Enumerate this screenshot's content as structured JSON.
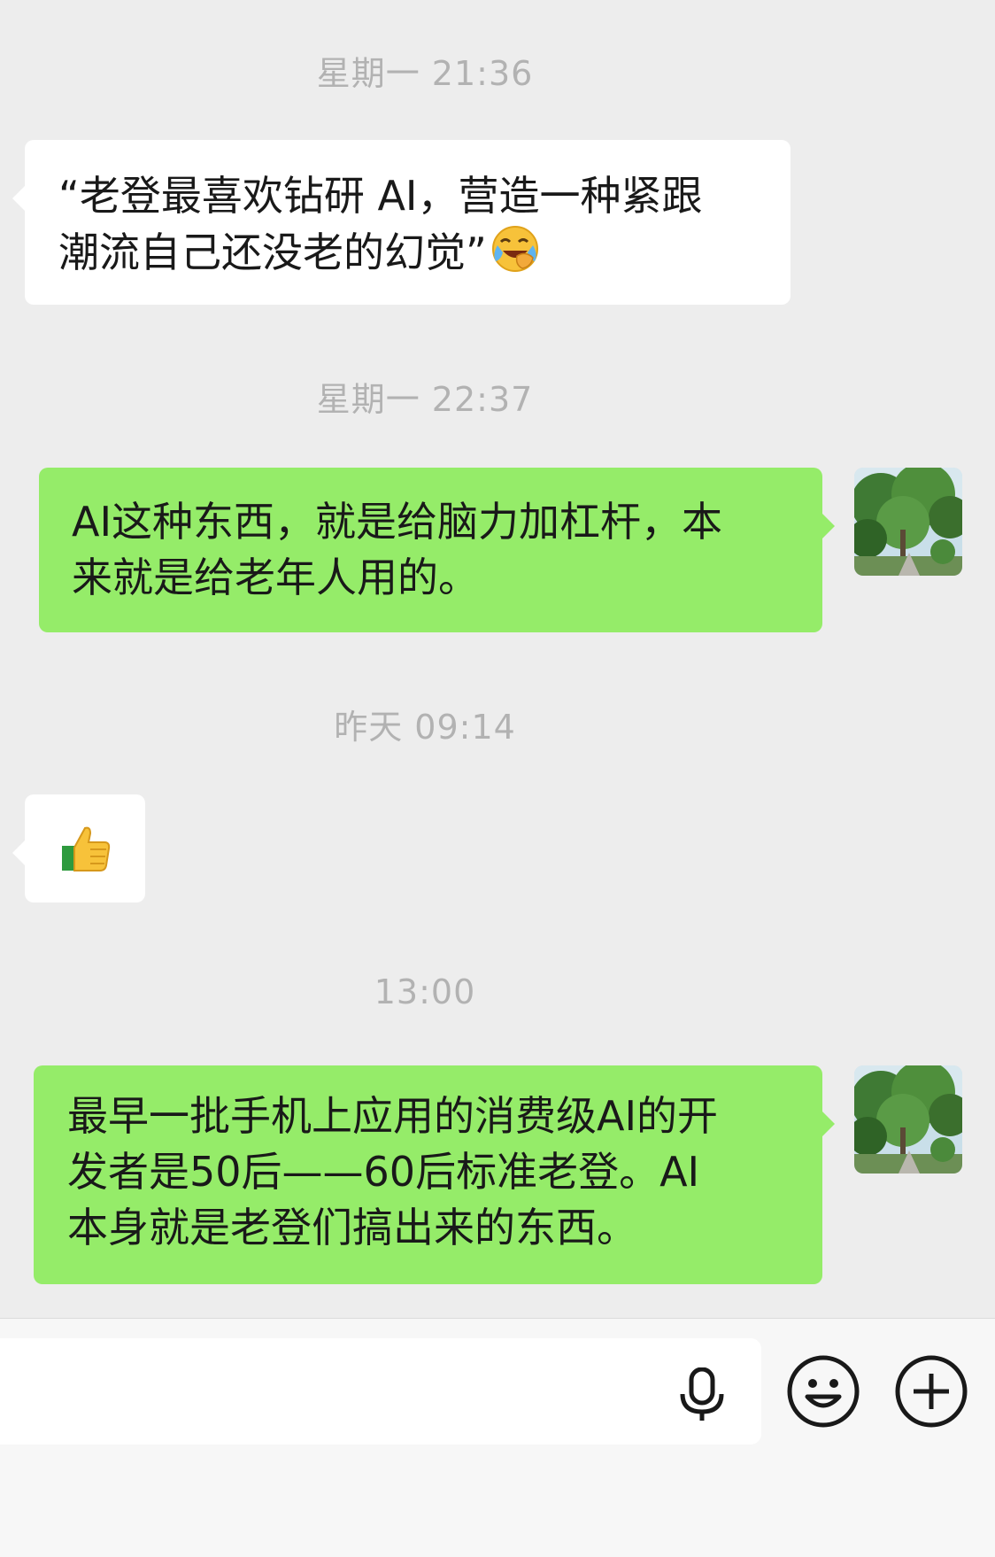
{
  "messages": [
    {
      "timestamp": "星期一 21:36",
      "side": "left",
      "lines": [
        "“老登最喜欢钻研 AI，营造一种紧跟",
        "潮流自己还没老的幻觉”"
      ],
      "trailing_emoji": "laughing-crying-emoji"
    },
    {
      "timestamp": "星期一 22:37",
      "side": "right",
      "lines": [
        "AI这种东西，就是给脑力加杠杆，本",
        "来就是给老年人用的。"
      ]
    },
    {
      "timestamp": "昨天 09:14",
      "side": "left",
      "emoji_only": "thumbs-up-emoji"
    },
    {
      "timestamp": "13:00",
      "side": "right",
      "lines": [
        "最早一批手机上应用的消费级AI的开",
        "发者是50后——60后标准老登。AI",
        "本身就是老登们搞出来的东西。"
      ]
    }
  ],
  "input_bar": {
    "icons": [
      "microphone-icon",
      "emoji-icon",
      "plus-icon"
    ]
  },
  "colors": {
    "background": "#ededed",
    "sent_bubble": "#95ec69",
    "received_bubble": "#ffffff",
    "timestamp": "#b2b2b2"
  }
}
